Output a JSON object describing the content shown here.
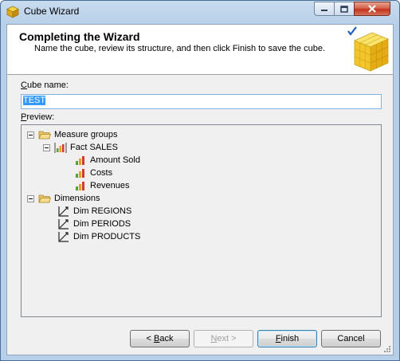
{
  "window": {
    "title": "Cube Wizard"
  },
  "header": {
    "title": "Completing the Wizard",
    "subtitle": "Name the cube, review its structure, and then click Finish to save the cube."
  },
  "cube_name": {
    "label": "Cube name:",
    "label_hotkey": "C",
    "label_rest": "ube name:",
    "value": "TEST"
  },
  "preview": {
    "label_hotkey": "P",
    "label_rest": "review:",
    "tree": {
      "measure_groups": "Measure groups",
      "fact": "Fact SALES",
      "measures": [
        "Amount Sold",
        "Costs",
        "Revenues"
      ],
      "dimensions_label": "Dimensions",
      "dimensions": [
        "Dim REGIONS",
        "Dim PERIODS",
        "Dim PRODUCTS"
      ]
    }
  },
  "buttons": {
    "back_prefix": "< ",
    "back_hotkey": "B",
    "back_rest": "ack",
    "next_hotkey": "N",
    "next_rest": "ext >",
    "finish_hotkey": "F",
    "finish_rest": "inish",
    "cancel": "Cancel"
  },
  "icons": {
    "app": "cube-icon",
    "folder": "folder-icon",
    "measure_group": "measure-group-icon",
    "measure": "measure-icon",
    "dimension": "dimension-icon"
  },
  "colors": {
    "accent": "#3399ff",
    "title_bar": "#b7cfe8",
    "close_button": "#c2321a"
  }
}
